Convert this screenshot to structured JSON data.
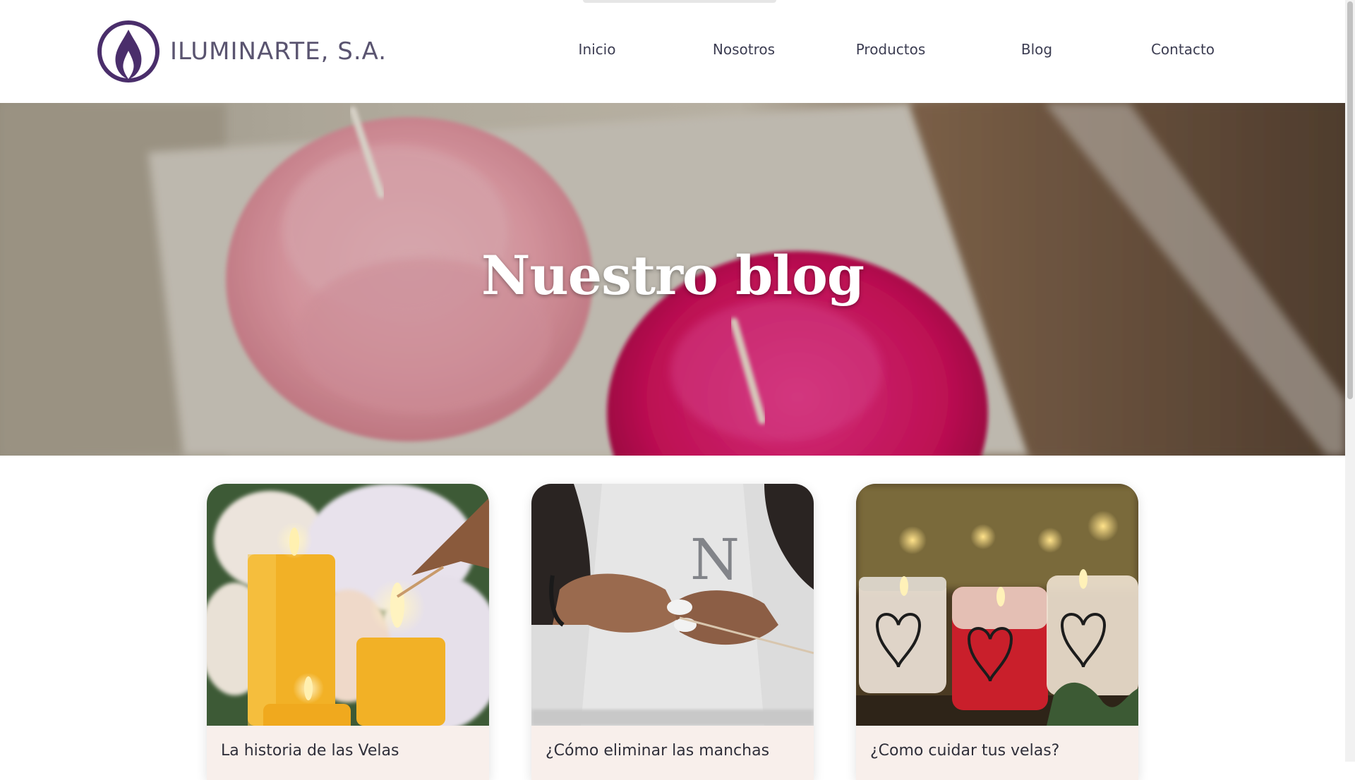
{
  "brand": {
    "name": "ILUMINARTE, S.A.",
    "icon": "flame-logo-icon",
    "color": "#4a2e6b"
  },
  "nav": {
    "items": [
      {
        "label": "Inicio"
      },
      {
        "label": "Nosotros"
      },
      {
        "label": "Productos"
      },
      {
        "label": "Blog"
      },
      {
        "label": "Contacto"
      }
    ]
  },
  "hero": {
    "title": "Nuestro blog"
  },
  "posts": [
    {
      "title": "La historia de las Velas"
    },
    {
      "title": "¿Cómo eliminar las manchas"
    },
    {
      "title": "¿Como cuidar tus velas?"
    }
  ],
  "colors": {
    "accent": "#4a2e6b",
    "card_bg": "#f8efeb",
    "text": "#3c3d52"
  }
}
